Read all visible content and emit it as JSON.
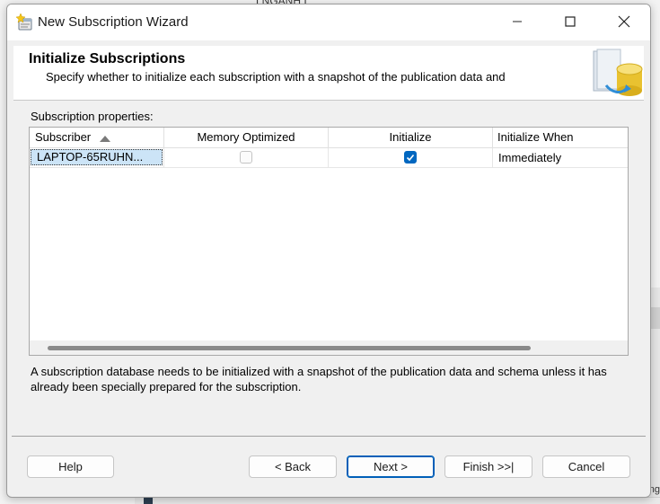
{
  "window": {
    "title": "New Subscription Wizard"
  },
  "background": {
    "top_text": "LNGANH I",
    "right_text": "ng"
  },
  "header": {
    "title": "Initialize Subscriptions",
    "subtitle": "Specify whether to initialize each subscription with a snapshot of the publication data and"
  },
  "grid": {
    "label": "Subscription properties:",
    "columns": [
      "Subscriber",
      "Memory Optimized",
      "Initialize",
      "Initialize When"
    ],
    "sort_column": "Subscriber",
    "sort_direction": "ascending",
    "rows": [
      {
        "subscriber": "LAPTOP-65RUHN...",
        "memory_optimized": false,
        "initialize": true,
        "initialize_when": "Immediately"
      }
    ]
  },
  "description": "A subscription database needs to be initialized with a snapshot of the publication data and schema unless it has already been specially prepared for the subscription.",
  "buttons": {
    "help": "Help",
    "back": "< Back",
    "next": "Next >",
    "finish": "Finish >>|",
    "cancel": "Cancel"
  },
  "colors": {
    "accent": "#0067c0",
    "selection": "#cce4f7"
  }
}
